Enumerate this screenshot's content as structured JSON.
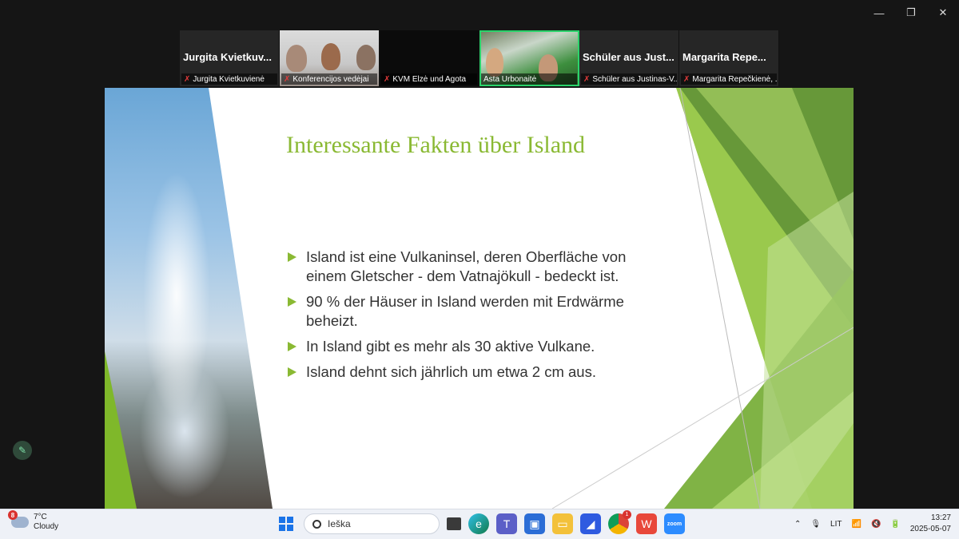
{
  "window": {
    "minimize": "—",
    "restore": "❐",
    "close": "✕"
  },
  "participants": [
    {
      "big_name": "Jurgita Kvietkuv...",
      "label": "Jurgita Kvietkuvienė",
      "muted": true
    },
    {
      "big_name": "",
      "label": "Konferencijos vedėjai",
      "muted": true
    },
    {
      "big_name": "",
      "label": "KVM Elzė und Agota",
      "muted": true
    },
    {
      "big_name": "",
      "label": "Asta Urbonaitė",
      "muted": false,
      "active": true
    },
    {
      "big_name": "Schüler aus Just...",
      "label": "Schüler aus Justinas-V...",
      "muted": true
    },
    {
      "big_name": "Margarita Repe...",
      "label": "Margarita Repečkienė, ...",
      "muted": true
    }
  ],
  "slide": {
    "title": "Interessante Fakten über Island",
    "bullets": [
      "Island ist eine Vulkaninsel, deren Oberfläche von einem Gletscher - dem Vatnajökull - bedeckt ist.",
      "90 % der Häuser in Island werden mit Erdwärme beheizt.",
      "In Island gibt es mehr als 30 aktive Vulkane.",
      "Island dehnt sich jährlich um etwa 2 cm aus."
    ],
    "accent_color": "#8ab933"
  },
  "taskbar": {
    "weather_temp": "7°C",
    "weather_desc": "Cloudy",
    "weather_badge": "8",
    "search_placeholder": "Ieška",
    "chrome_badge": "1",
    "language": "LIT",
    "time": "13:27",
    "date": "2025-05-07",
    "zoom_app": "zoom",
    "icons": [
      "windows-start-icon",
      "search-icon",
      "task-view-icon",
      "edge-icon",
      "teams-icon",
      "store-icon",
      "file-explorer-icon",
      "mindmap-icon",
      "chrome-icon",
      "wps-office-icon",
      "zoom-icon"
    ]
  }
}
